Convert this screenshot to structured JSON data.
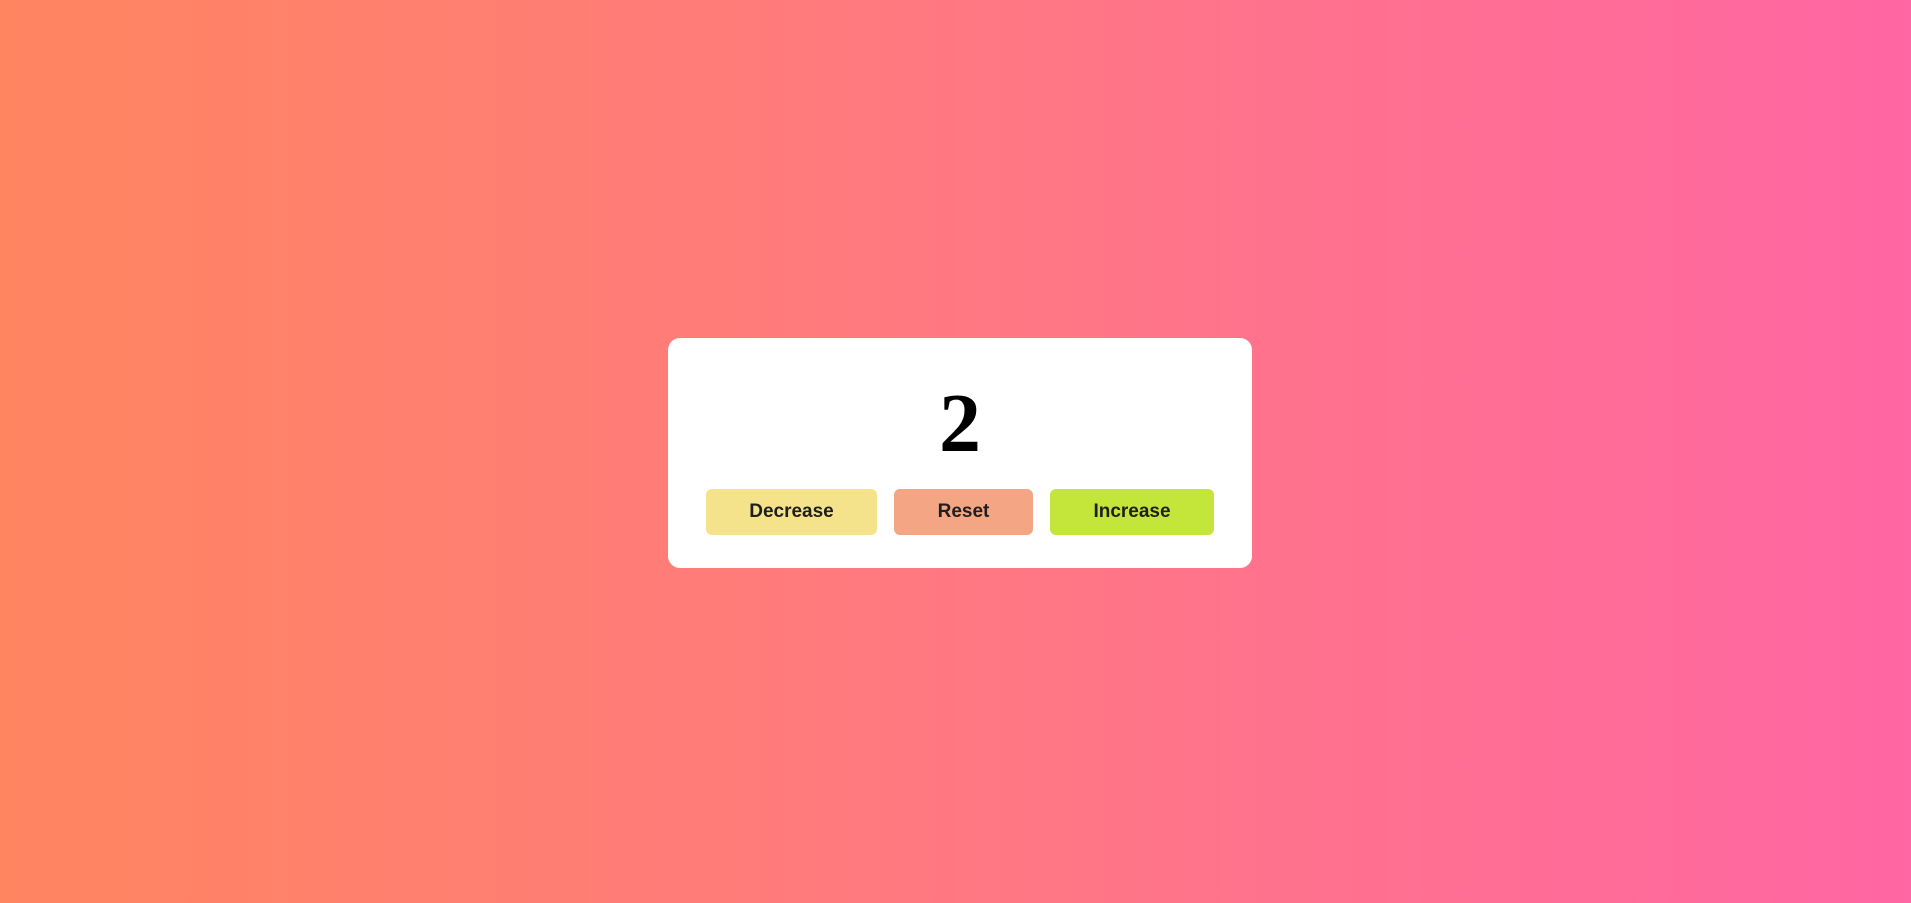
{
  "counter": {
    "value": "2"
  },
  "buttons": {
    "decrease_label": "Decrease",
    "reset_label": "Reset",
    "increase_label": "Increase"
  },
  "colors": {
    "background_start": "#ff8560",
    "background_end": "#ff66a3",
    "card": "#ffffff",
    "decrease": "#f5e38c",
    "reset": "#f3a584",
    "increase": "#c4e53a"
  }
}
